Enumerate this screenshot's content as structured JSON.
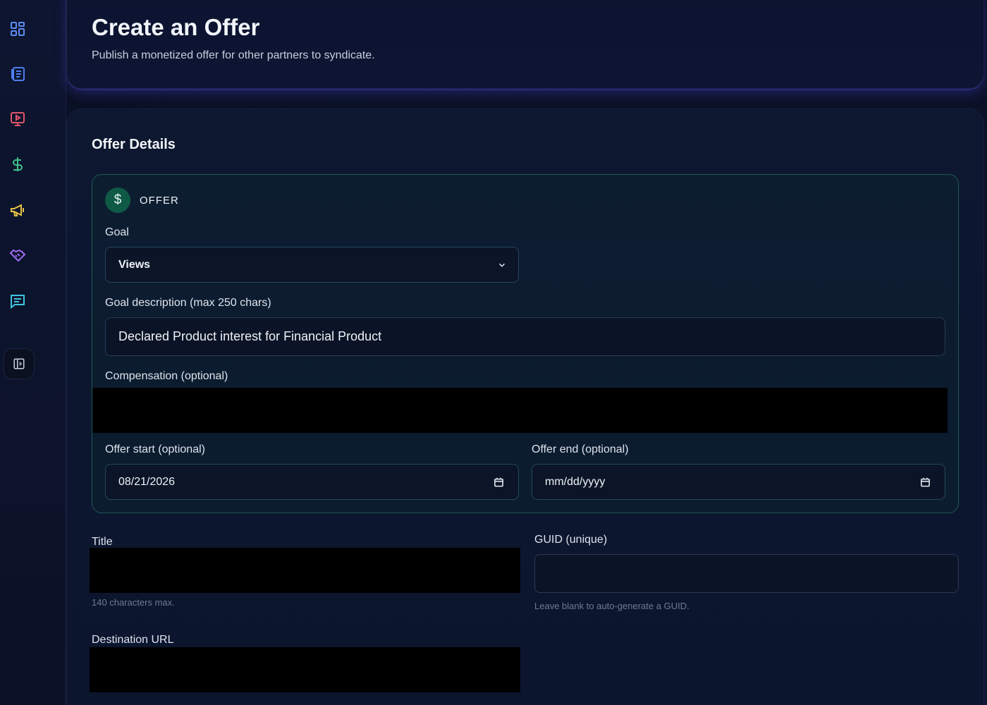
{
  "sidebar": {
    "items": [
      {
        "icon": "dashboard-grid-icon",
        "color": "#5b8cf0"
      },
      {
        "icon": "newspaper-icon",
        "color": "#4f7ef0"
      },
      {
        "icon": "video-play-icon",
        "color": "#e0566a"
      },
      {
        "icon": "dollar-icon",
        "color": "#3fbf8a"
      },
      {
        "icon": "megaphone-icon",
        "color": "#e8c244"
      },
      {
        "icon": "handshake-icon",
        "color": "#a06cf0"
      },
      {
        "icon": "message-icon",
        "color": "#3fc4e0"
      }
    ],
    "collapse_icon": "sidebar-toggle-icon"
  },
  "header": {
    "title": "Create an Offer",
    "subtitle": "Publish a monetized offer for other partners to syndicate."
  },
  "form": {
    "section_title": "Offer Details",
    "offer": {
      "badge_symbol": "$",
      "label": "OFFER",
      "goal_label": "Goal",
      "goal_value": "Views",
      "goal_description_label": "Goal description (max 250 chars)",
      "goal_description_value": "Declared Product interest for Financial Product",
      "compensation_label": "Compensation (optional)",
      "offer_start_label": "Offer start (optional)",
      "offer_start_value": "08/21/2026",
      "offer_end_label": "Offer end (optional)",
      "offer_end_value": "mm/dd/yyyy"
    },
    "title_label": "Title",
    "title_hint": "140 characters max.",
    "guid_label": "GUID (unique)",
    "guid_value": "",
    "guid_hint": "Leave blank to auto-generate a GUID.",
    "destination_url_label": "Destination URL"
  },
  "colors": {
    "accent_green": "#0f5a46",
    "offer_border": "#1e5a54",
    "header_glow": "#5046dc"
  }
}
